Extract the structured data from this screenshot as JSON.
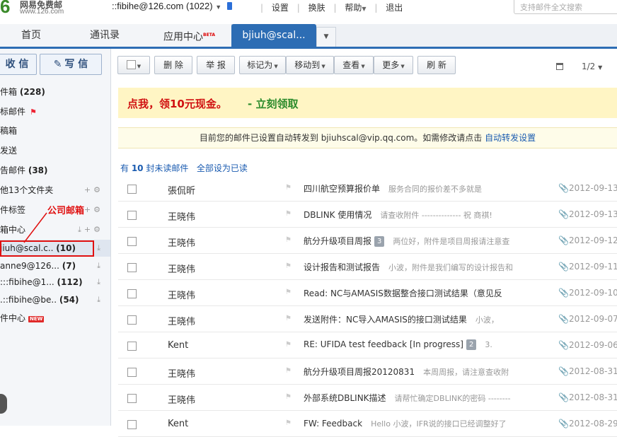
{
  "brand": {
    "logo_char": "6",
    "name": "网易免费邮",
    "url": "www.126.com"
  },
  "account": {
    "name": "::fibihe@126.com",
    "unread": "(1022)"
  },
  "top_links": [
    {
      "label": "设置"
    },
    {
      "label": "换肤"
    },
    {
      "label": "帮助"
    },
    {
      "label": "退出"
    }
  ],
  "search": {
    "placeholder": "支持邮件全文搜索"
  },
  "tabs": [
    {
      "label": "首页"
    },
    {
      "label": "通讯录"
    },
    {
      "label": "应用中心",
      "badge": "BETA"
    },
    {
      "label": "bjiuh@scal...",
      "active": true
    }
  ],
  "sidebar": {
    "receive_label": "收 信",
    "write_label": "写 信",
    "items": [
      {
        "label": "件箱 ",
        "count": "(228)"
      },
      {
        "label": "标邮件",
        "flag": true
      },
      {
        "label": "稿箱"
      },
      {
        "label": "发送"
      },
      {
        "label": "告邮件 ",
        "count": "(38)"
      },
      {
        "label": "他13个文件夹"
      },
      {
        "label": "件标签"
      },
      {
        "label": "箱中心"
      },
      {
        "label": "jiuh@scal.c.. ",
        "count": "(10)"
      },
      {
        "label": "anne9@126... ",
        "count": "(7)"
      },
      {
        "label": ":::fibihe@1... ",
        "count": "(112)"
      },
      {
        "label": ".::fibihe@be.. ",
        "count": "(54)"
      },
      {
        "label": "件中心",
        "badge": "NEW"
      }
    ],
    "annotation": "公司邮箱"
  },
  "toolbar": {
    "delete": "删 除",
    "report": "举 报",
    "mark": "标记为",
    "move": "移动到",
    "view": "查看",
    "more": "更多",
    "refresh": "刷 新",
    "pager": "1/2"
  },
  "promo": {
    "main": "点我，领10元现金。",
    "link": "- 立刻领取"
  },
  "notice": {
    "text": "目前您的邮件已设置自动转发到 bjiuhscal@vip.qq.com。如需修改请点击 ",
    "link": "自动转发设置"
  },
  "unread_bar": {
    "prefix": "有 ",
    "count": "10",
    "suffix": " 封未读邮件",
    "mark_all": "全部设为已读"
  },
  "emails": [
    {
      "sender": "張侃昕",
      "subject": "四川航空预算报价单",
      "count": "",
      "preview": "服务合同的报价差不多就是",
      "date": "2012-09-13"
    },
    {
      "sender": "王晓伟",
      "subject": "DBLINK 使用情况",
      "count": "",
      "preview": "请查收附件 -------------- 祝 商祺!",
      "date": "2012-09-13"
    },
    {
      "sender": "王晓伟",
      "subject": "航分升级项目周报",
      "count": "3",
      "preview": "两位好，附件是项目周报请注意查",
      "date": "2012-09-12"
    },
    {
      "sender": "王晓伟",
      "subject": "设计报告和测试报告",
      "count": "",
      "preview": "小波，附件是我们编写的设计报告和",
      "date": "2012-09-11"
    },
    {
      "sender": "王晓伟",
      "subject": "Read: NC与AMASIS数据整合接口测试结果（意见反",
      "count": "",
      "preview": "",
      "date": "2012-09-10"
    },
    {
      "sender": "王晓伟",
      "subject": "发送附件：NC导入AMASIS的接口测试结果",
      "count": "",
      "preview": "小波，",
      "date": "2012-09-07"
    },
    {
      "sender": "Kent",
      "subject": "RE: UFIDA test feedback [In progress]",
      "count": "2",
      "preview": "3.",
      "date": "2012-09-06"
    },
    {
      "sender": "王晓伟",
      "subject": "航分升级项目周报20120831",
      "count": "",
      "preview": "本周周报，请注意查收附",
      "date": "2012-08-31"
    },
    {
      "sender": "王晓伟",
      "subject": "外部系统DBLINK描述",
      "count": "",
      "preview": "请帮忙确定DBLINK的密码 --------",
      "date": "2012-08-31"
    },
    {
      "sender": "Kent",
      "subject": "FW: Feedback",
      "count": "",
      "preview": "Hello 小波，IFR说的接口已经调整好了",
      "date": "2012-08-29"
    }
  ]
}
